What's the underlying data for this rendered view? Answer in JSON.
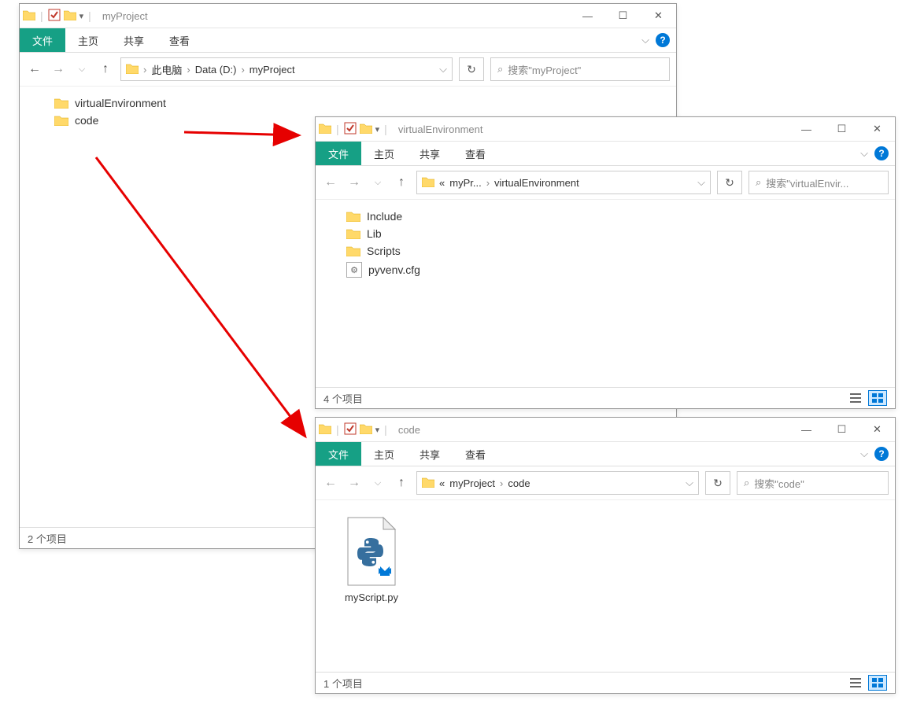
{
  "ribbon": {
    "file": "文件",
    "home": "主页",
    "share": "共享",
    "view": "查看"
  },
  "windowA": {
    "title": "myProject",
    "breadcrumb": [
      "此电脑",
      "Data (D:)",
      "myProject"
    ],
    "searchPlaceholder": "搜索\"myProject\"",
    "items": [
      {
        "name": "virtualEnvironment",
        "type": "folder"
      },
      {
        "name": "code",
        "type": "folder"
      }
    ],
    "status": "2 个项目"
  },
  "windowB": {
    "title": "virtualEnvironment",
    "breadcrumbPrefix": "«",
    "breadcrumb": [
      "myPr...",
      "virtualEnvironment"
    ],
    "searchPlaceholder": "搜索\"virtualEnvir...",
    "items": [
      {
        "name": "Include",
        "type": "folder"
      },
      {
        "name": "Lib",
        "type": "folder"
      },
      {
        "name": "Scripts",
        "type": "folder"
      },
      {
        "name": "pyvenv.cfg",
        "type": "config"
      }
    ],
    "status": "4 个项目"
  },
  "windowC": {
    "title": "code",
    "breadcrumbPrefix": "«",
    "breadcrumb": [
      "myProject",
      "code"
    ],
    "searchPlaceholder": "搜索\"code\"",
    "items": [
      {
        "name": "myScript.py",
        "type": "python"
      }
    ],
    "status": "1 个项目"
  }
}
